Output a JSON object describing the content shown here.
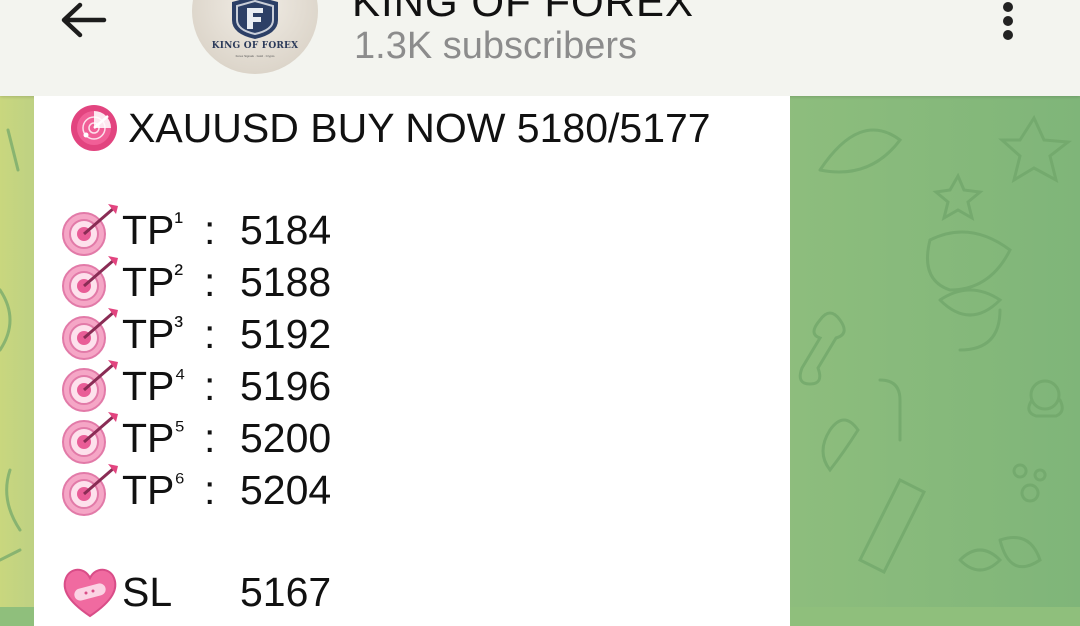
{
  "header": {
    "channel_title": "KING OF FOREX",
    "subscribers": "1.3K subscribers",
    "avatar": {
      "brand_text": "KING OF FOREX",
      "tagline": "Forex Signals · Gold · Crypto"
    },
    "icons": {
      "back": "arrow-left-icon",
      "menu": "more-vertical-icon"
    }
  },
  "message": {
    "headline_icon": "radar-icon",
    "headline": "XAUUSD BUY NOW 5180/5177",
    "targets": [
      {
        "label": "TP",
        "sup": "¹",
        "value": "5184",
        "icon": "target-dart-icon"
      },
      {
        "label": "TP",
        "sup": "²",
        "value": "5188",
        "icon": "target-dart-icon"
      },
      {
        "label": "TP",
        "sup": "³",
        "value": "5192",
        "icon": "target-dart-icon"
      },
      {
        "label": "TP",
        "sup": "⁴",
        "value": "5196",
        "icon": "target-dart-icon"
      },
      {
        "label": "TP",
        "sup": "⁵",
        "value": "5200",
        "icon": "target-dart-icon"
      },
      {
        "label": "TP",
        "sup": "⁶",
        "value": "5204",
        "icon": "target-dart-icon"
      }
    ],
    "separator": ":",
    "stop_loss": {
      "label": "SL",
      "value": "5167",
      "icon": "mending-heart-icon"
    }
  },
  "colors": {
    "header_bg": "#f3f4ef",
    "wallpaper_green": "#8dbd7d",
    "bubble_bg": "#ffffff",
    "emoji_pink": "#f48bb5"
  }
}
